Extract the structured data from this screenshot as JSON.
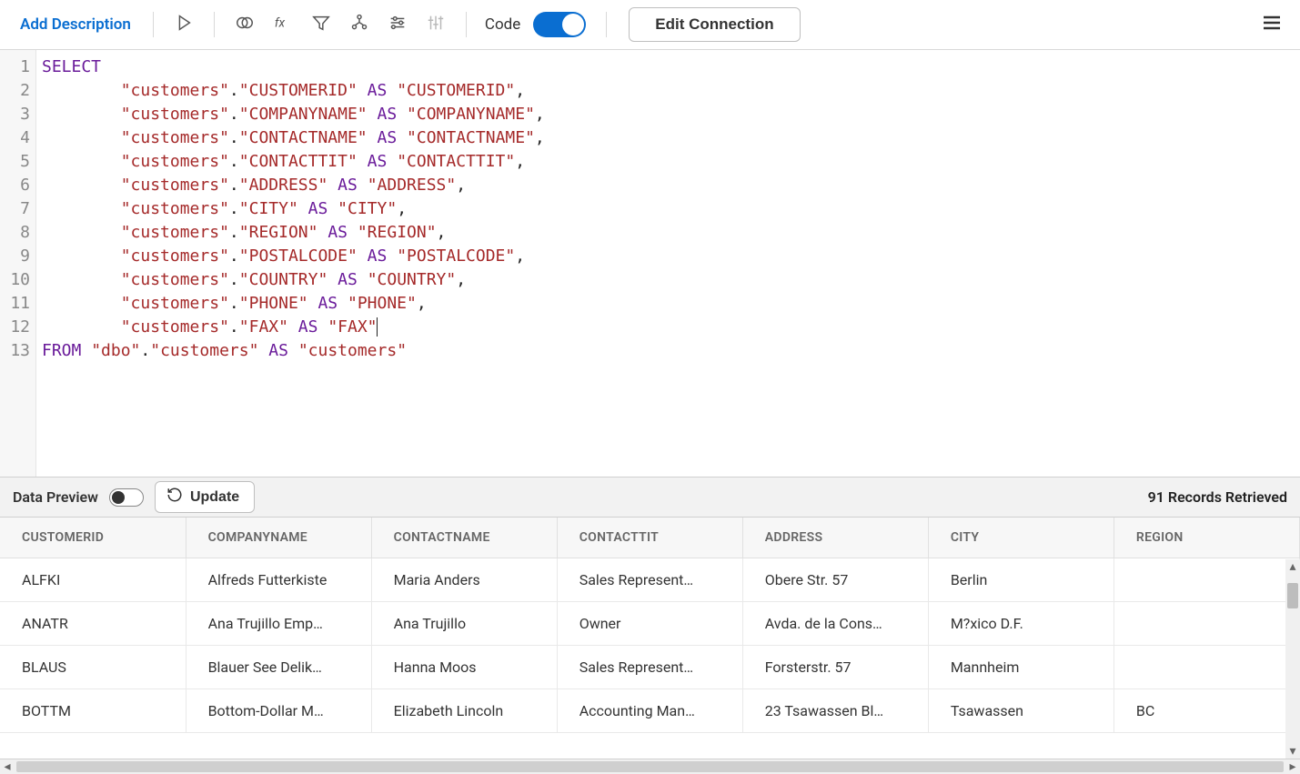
{
  "toolbar": {
    "add_description": "Add Description",
    "code_label": "Code",
    "edit_connection": "Edit Connection"
  },
  "sql": {
    "select": "SELECT",
    "from": "FROM",
    "as": "AS",
    "columns": [
      {
        "src_tbl": "\"customers\"",
        "src_col": "\"CUSTOMERID\"",
        "alias": "\"CUSTOMERID\""
      },
      {
        "src_tbl": "\"customers\"",
        "src_col": "\"COMPANYNAME\"",
        "alias": "\"COMPANYNAME\""
      },
      {
        "src_tbl": "\"customers\"",
        "src_col": "\"CONTACTNAME\"",
        "alias": "\"CONTACTNAME\""
      },
      {
        "src_tbl": "\"customers\"",
        "src_col": "\"CONTACTTIT\"",
        "alias": "\"CONTACTTIT\""
      },
      {
        "src_tbl": "\"customers\"",
        "src_col": "\"ADDRESS\"",
        "alias": "\"ADDRESS\""
      },
      {
        "src_tbl": "\"customers\"",
        "src_col": "\"CITY\"",
        "alias": "\"CITY\""
      },
      {
        "src_tbl": "\"customers\"",
        "src_col": "\"REGION\"",
        "alias": "\"REGION\""
      },
      {
        "src_tbl": "\"customers\"",
        "src_col": "\"POSTALCODE\"",
        "alias": "\"POSTALCODE\""
      },
      {
        "src_tbl": "\"customers\"",
        "src_col": "\"COUNTRY\"",
        "alias": "\"COUNTRY\""
      },
      {
        "src_tbl": "\"customers\"",
        "src_col": "\"PHONE\"",
        "alias": "\"PHONE\""
      },
      {
        "src_tbl": "\"customers\"",
        "src_col": "\"FAX\"",
        "alias": "\"FAX\""
      }
    ],
    "from_schema": "\"dbo\"",
    "from_table": "\"customers\"",
    "from_alias": "\"customers\""
  },
  "preview": {
    "label": "Data Preview",
    "update": "Update",
    "records": "91 Records Retrieved"
  },
  "table": {
    "headers": [
      "CUSTOMERID",
      "COMPANYNAME",
      "CONTACTNAME",
      "CONTACTTIT",
      "ADDRESS",
      "CITY",
      "REGION"
    ],
    "rows": [
      [
        "ALFKI",
        "Alfreds Futterkiste",
        "Maria Anders",
        "Sales Represent…",
        "Obere Str. 57",
        "Berlin",
        ""
      ],
      [
        "ANATR",
        "Ana Trujillo Emp…",
        "Ana Trujillo",
        "Owner",
        "Avda. de la Cons…",
        "M?xico D.F.",
        ""
      ],
      [
        "BLAUS",
        "Blauer See Delik…",
        "Hanna Moos",
        "Sales Represent…",
        "Forsterstr. 57",
        "Mannheim",
        ""
      ],
      [
        "BOTTM",
        "Bottom-Dollar M…",
        "Elizabeth Lincoln",
        "Accounting Man…",
        "23 Tsawassen Bl…",
        "Tsawassen",
        "BC"
      ]
    ]
  }
}
